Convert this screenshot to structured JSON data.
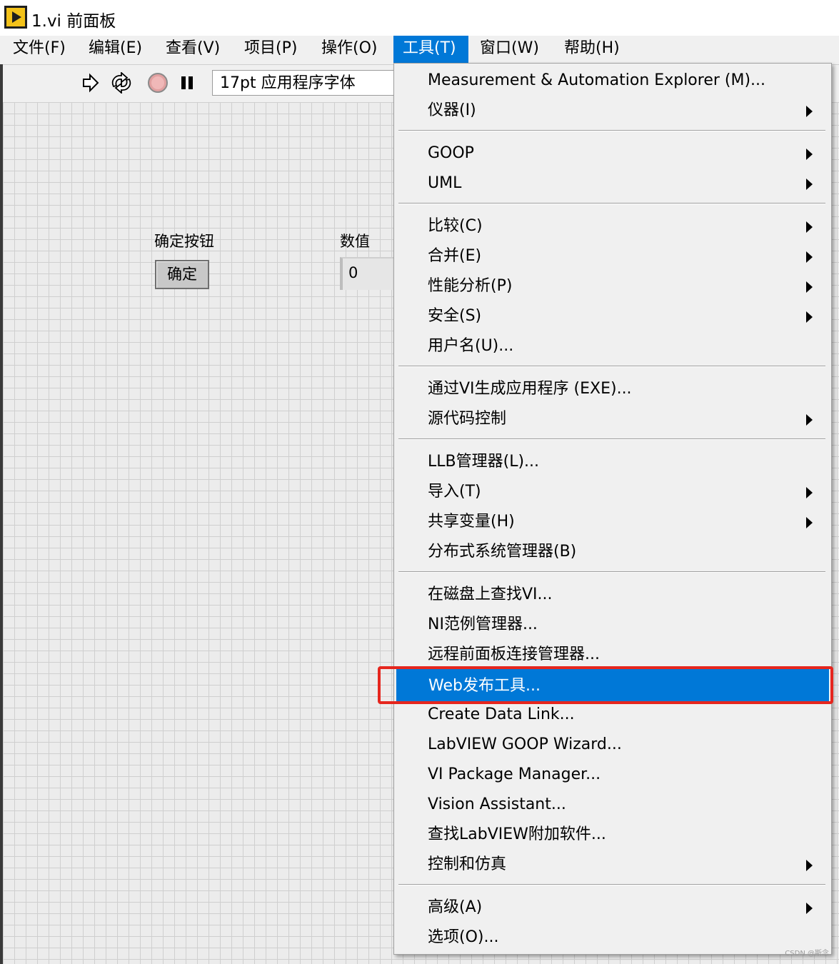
{
  "window": {
    "title": "1.vi 前面板"
  },
  "menubar": {
    "items": [
      {
        "label": "文件(F)"
      },
      {
        "label": "编辑(E)"
      },
      {
        "label": "查看(V)"
      },
      {
        "label": "项目(P)"
      },
      {
        "label": "操作(O)"
      },
      {
        "label": "工具(T)",
        "active": true
      },
      {
        "label": "窗口(W)"
      },
      {
        "label": "帮助(H)"
      }
    ]
  },
  "toolbar": {
    "run_icon": "run-arrow-icon",
    "run_continuous_icon": "run-continuously-icon",
    "abort_icon": "abort-icon",
    "pause_icon": "pause-icon",
    "font_select": "17pt 应用程序字体"
  },
  "panel": {
    "button_label": "确定按钮",
    "button_text": "确定",
    "numeric_label": "数值",
    "numeric_value": "0"
  },
  "tools_menu": {
    "items": [
      {
        "label": "Measurement & Automation Explorer (M)..."
      },
      {
        "label": "仪器(I)",
        "submenu": true
      },
      {
        "label": "GOOP",
        "submenu": true
      },
      {
        "label": "UML",
        "submenu": true
      },
      {
        "label": "比较(C)",
        "submenu": true
      },
      {
        "label": "合并(E)",
        "submenu": true
      },
      {
        "label": "性能分析(P)",
        "submenu": true
      },
      {
        "label": "安全(S)",
        "submenu": true
      },
      {
        "label": "用户名(U)..."
      },
      {
        "label": "通过VI生成应用程序 (EXE)..."
      },
      {
        "label": "源代码控制",
        "submenu": true
      },
      {
        "label": "LLB管理器(L)..."
      },
      {
        "label": "导入(T)",
        "submenu": true
      },
      {
        "label": "共享变量(H)",
        "submenu": true
      },
      {
        "label": "分布式系统管理器(B)"
      },
      {
        "label": "在磁盘上查找VI..."
      },
      {
        "label": "NI范例管理器..."
      },
      {
        "label": "远程前面板连接管理器..."
      },
      {
        "label": "Web发布工具...",
        "highlighted": true
      },
      {
        "label": "Create Data Link..."
      },
      {
        "label": "LabVIEW GOOP Wizard..."
      },
      {
        "label": "VI Package Manager..."
      },
      {
        "label": "Vision Assistant..."
      },
      {
        "label": "查找LabVIEW附加软件..."
      },
      {
        "label": "控制和仿真",
        "submenu": true
      },
      {
        "label": "高级(A)",
        "submenu": true
      },
      {
        "label": "选项(O)..."
      }
    ]
  },
  "highlight_color": "#0078d7",
  "callout_color": "#e5261e",
  "watermark": "CSDN @斯念"
}
